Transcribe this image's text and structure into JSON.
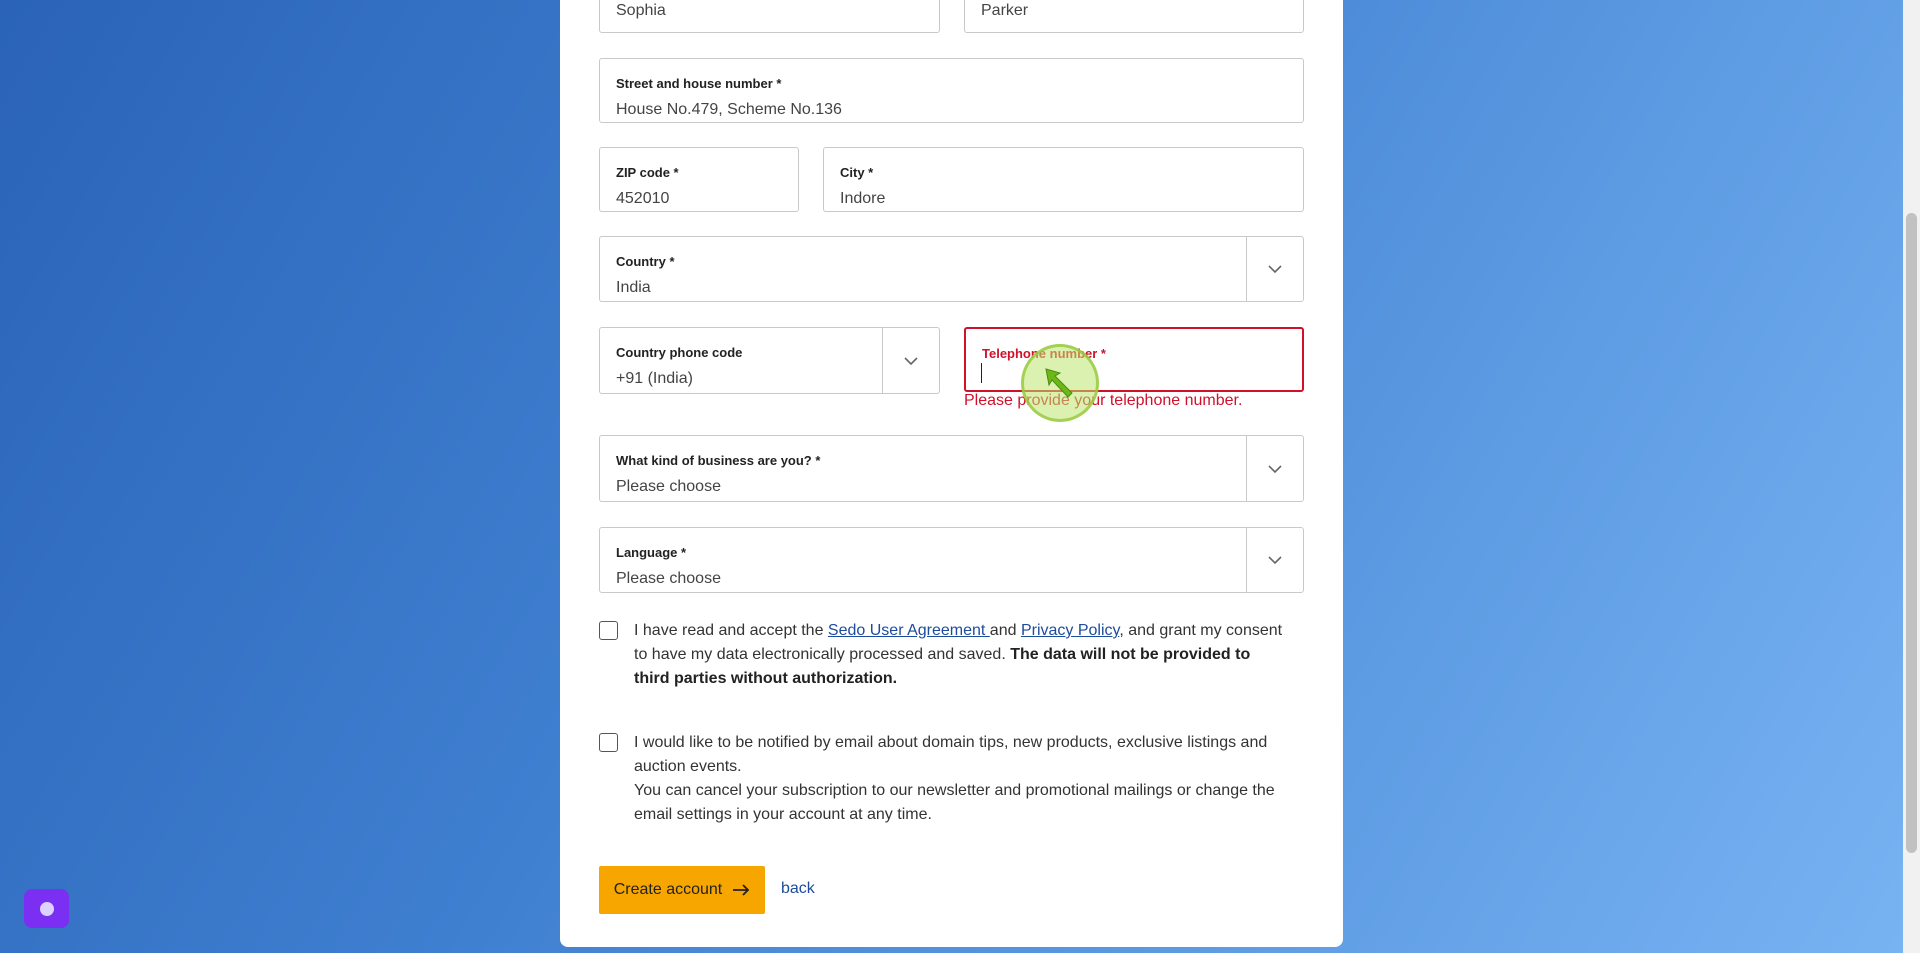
{
  "form": {
    "first_name": {
      "value": "Sophia"
    },
    "last_name": {
      "value": "Parker"
    },
    "street": {
      "label": "Street and house number *",
      "value": "House No.479, Scheme No.136"
    },
    "zip": {
      "label": "ZIP code *",
      "value": "452010"
    },
    "city": {
      "label": "City *",
      "value": "Indore"
    },
    "country": {
      "label": "Country *",
      "value": "India"
    },
    "phone_code": {
      "label": "Country phone code",
      "value": "+91 (India)"
    },
    "telephone": {
      "label": "Telephone number *",
      "value": "",
      "error": "Please provide your telephone number."
    },
    "business": {
      "label": "What kind of business are you? *",
      "value": "Please choose"
    },
    "language": {
      "label": "Language *",
      "value": "Please choose"
    }
  },
  "consent": {
    "part1": "I have read and accept the ",
    "user_agreement_link": "Sedo User Agreement ",
    "part2": "and ",
    "privacy_link": "Privacy Policy",
    "part3": ", and grant my consent to have my data electronically processed and saved. ",
    "bold": "The data will not be provided to third parties without authorization."
  },
  "newsletter": {
    "line1": "I would like to be notified by email about domain tips, new products, exclusive listings and auction events.",
    "line2": "You can cancel your subscription to our newsletter and promotional mailings or change the email settings in your account at any time."
  },
  "actions": {
    "create_account": "Create account",
    "back": "back"
  },
  "icons": {
    "dropdown": "chevron-down-icon",
    "arrow": "arrow-right-icon",
    "chat": "chat-widget-icon"
  },
  "colors": {
    "accent_button": "#f7a600",
    "error": "#d0112b",
    "link": "#1d4c9c"
  }
}
